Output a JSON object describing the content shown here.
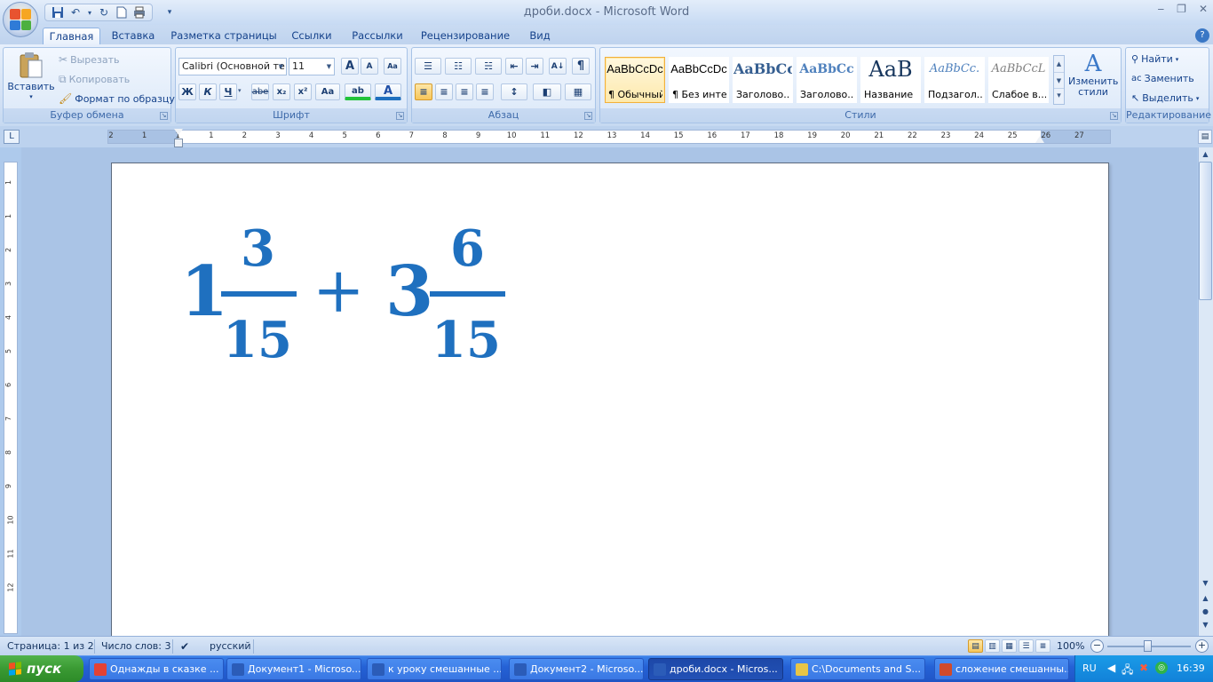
{
  "window": {
    "title": "дроби.docx - Microsoft Word",
    "minimize": "‒",
    "maximize": "❐",
    "close": "✕"
  },
  "qat": {
    "customize": "▾"
  },
  "tabs": [
    {
      "label": "Главная",
      "active": true
    },
    {
      "label": "Вставка"
    },
    {
      "label": "Разметка страницы"
    },
    {
      "label": "Ссылки"
    },
    {
      "label": "Рассылки"
    },
    {
      "label": "Рецензирование"
    },
    {
      "label": "Вид"
    }
  ],
  "help": "?",
  "clipboard": {
    "paste": "Вставить",
    "cut": "Вырезать",
    "copy": "Копировать",
    "format_painter": "Формат по образцу",
    "group": "Буфер обмена"
  },
  "font": {
    "name": "Calibri (Основной те",
    "size": "11",
    "grow": "A",
    "shrink": "A",
    "clear": "Aa",
    "bold": "Ж",
    "italic": "К",
    "underline": "Ч",
    "strike": "abe",
    "subscript": "x₂",
    "superscript": "x²",
    "case": "Aa",
    "highlight": "ab",
    "color": "A",
    "group": "Шрифт"
  },
  "paragraph": {
    "bullets": "☰",
    "numbering": "☷",
    "multilevel": "☵",
    "decrease_indent": "⇤",
    "increase_indent": "⇥",
    "sort": "A↓",
    "pilcrow": "¶",
    "align_left": "≡",
    "center": "≡",
    "align_right": "≡",
    "justify": "≡",
    "line_spacing": "↕",
    "shading": "◧",
    "borders": "▦",
    "group": "Абзац"
  },
  "styles": {
    "items": [
      {
        "preview": "AaBbCcDc",
        "name": "¶ Обычный",
        "selected": true
      },
      {
        "preview": "AaBbCcDc",
        "name": "¶ Без инте..."
      },
      {
        "preview": "AaBbCc",
        "name": "Заголово..."
      },
      {
        "preview": "AaBbCc",
        "name": "Заголово..."
      },
      {
        "preview": "AaB",
        "name": "Название"
      },
      {
        "preview": "AaBbCc.",
        "name": "Подзагол..."
      },
      {
        "preview": "AaBbCcL",
        "name": "Слабое в..."
      }
    ],
    "scroll_up": "▲",
    "scroll_down": "▼",
    "more": "▾",
    "change": "Изменить стили",
    "change_icon": "A",
    "group": "Стили"
  },
  "editing": {
    "find": "Найти",
    "replace": "Заменить",
    "select": "Выделить",
    "group": "Редактирование"
  },
  "ruler": {
    "corner": "L",
    "h_labels": [
      "2",
      "1",
      "1",
      "1",
      "2",
      "3",
      "4",
      "5",
      "6",
      "7",
      "8",
      "9",
      "10",
      "11",
      "12",
      "13",
      "14",
      "15",
      "16",
      "17",
      "18",
      "19",
      "20",
      "21",
      "22",
      "23",
      "24",
      "25",
      "26",
      "27"
    ],
    "v_labels": [
      "1",
      "1",
      "2",
      "3",
      "4",
      "5",
      "6",
      "7",
      "8",
      "9",
      "10",
      "11",
      "12"
    ]
  },
  "document": {
    "math": {
      "whole1": "1",
      "num1": "3",
      "den1": "15",
      "op": "+",
      "whole2": "3",
      "num2": "6",
      "den2": "15"
    }
  },
  "scrollbar": {
    "up": "▲",
    "down": "▼",
    "prev_page": "▲",
    "browse": "●",
    "next_page": "▼"
  },
  "status": {
    "page": "Страница: 1 из 2",
    "words": "Число слов: 3",
    "language": "русский",
    "zoom": "100%",
    "zoom_out": "−",
    "zoom_in": "+"
  },
  "taskbar": {
    "start": "пуск",
    "tasks": [
      {
        "label": "Однажды в сказке ...",
        "color": "#e34234"
      },
      {
        "label": "Документ1 - Microso...",
        "color": "#2b5cb8"
      },
      {
        "label": "к уроку смешанные ...",
        "color": "#2b5cb8"
      },
      {
        "label": "Документ2 - Microso...",
        "color": "#2b5cb8"
      },
      {
        "label": "дроби.docx - Micros...",
        "color": "#2b5cb8",
        "active": true
      },
      {
        "label": "C:\\Documents and S...",
        "color": "#e8c547"
      },
      {
        "label": "сложение смешанны...",
        "color": "#d04a2a"
      }
    ],
    "lang": "RU",
    "time": "16:39"
  }
}
